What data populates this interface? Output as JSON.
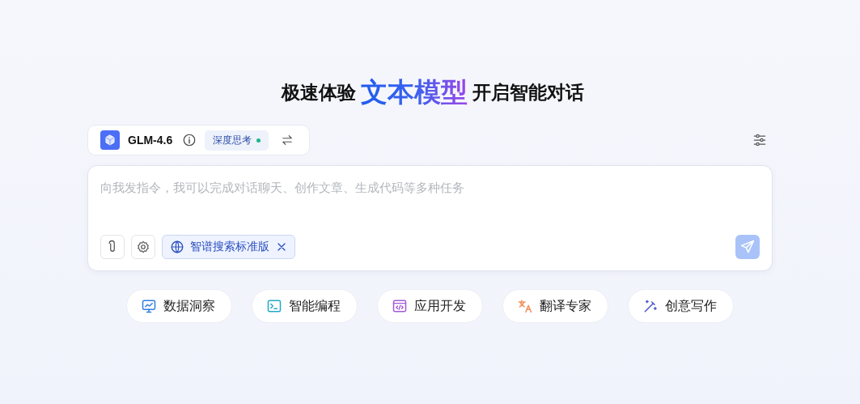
{
  "headline": {
    "before": "极速体验",
    "highlight": "文本模型",
    "after": "开启智能对话"
  },
  "model_bar": {
    "model": "GLM-4.6",
    "mode": {
      "label": "深度思考",
      "on": true
    }
  },
  "composer": {
    "placeholder": "向我发指令，我可以完成对话聊天、创作文章、生成代码等多种任务",
    "tool_tag": "智谱搜索标准版",
    "send_disabled": true
  },
  "shortcuts": [
    {
      "label": "数据洞察",
      "kind": "chart",
      "color": "#2f7de1"
    },
    {
      "label": "智能编程",
      "kind": "terminal",
      "color": "#22a7c9"
    },
    {
      "label": "应用开发",
      "kind": "code",
      "color": "#a05ad8"
    },
    {
      "label": "翻译专家",
      "kind": "translate",
      "color": "#f0905a"
    },
    {
      "label": "创意写作",
      "kind": "wand",
      "color": "#4a55c8"
    }
  ]
}
